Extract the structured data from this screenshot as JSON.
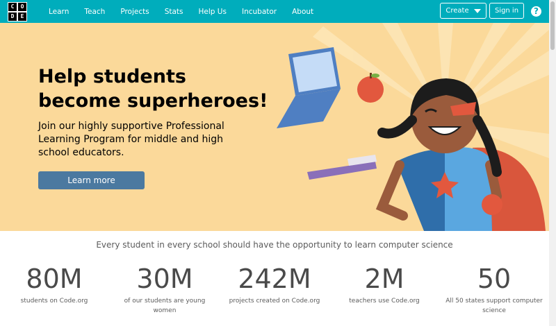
{
  "nav": {
    "logo_letters": [
      "C",
      "O",
      "D",
      "E"
    ],
    "links": [
      "Learn",
      "Teach",
      "Projects",
      "Stats",
      "Help Us",
      "Incubator",
      "About"
    ],
    "create_label": "Create",
    "signin_label": "Sign in",
    "help_label": "?"
  },
  "hero": {
    "title": "Help students become superheroes!",
    "description": "Join our highly supportive Professional Learning Program for middle and high school educators.",
    "button_label": "Learn more"
  },
  "stats": {
    "tagline": "Every student in every school should have the opportunity to learn computer science",
    "items": [
      {
        "value": "80M",
        "label": "students on Code.org"
      },
      {
        "value": "30M",
        "label": "of our students are young women"
      },
      {
        "value": "242M",
        "label": "projects created on Code.org"
      },
      {
        "value": "2M",
        "label": "teachers use Code.org"
      },
      {
        "value": "50",
        "label": "All 50 states support computer science"
      }
    ]
  },
  "colors": {
    "nav": "#00adbc",
    "hero_bg": "#fbd99a",
    "button": "#4b79a0"
  }
}
